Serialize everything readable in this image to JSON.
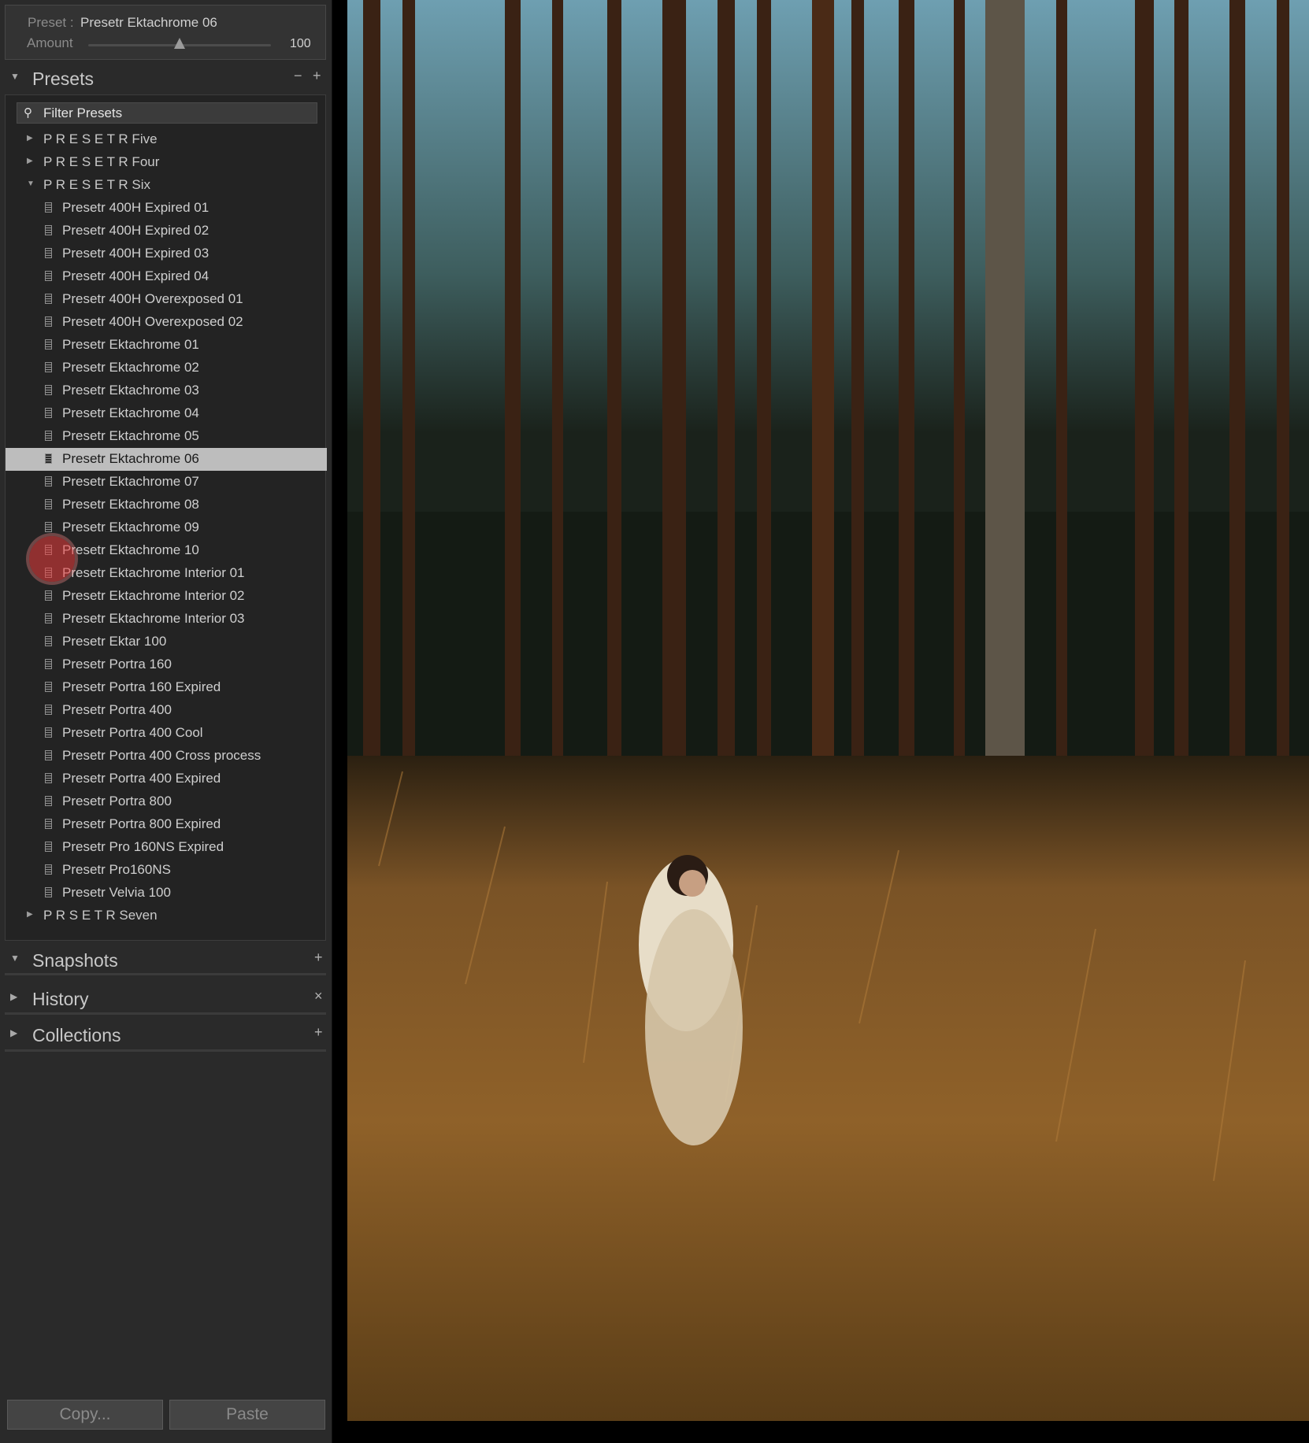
{
  "preset_bar": {
    "preset_label": "Preset :",
    "preset_value": "Presetr Ektachrome 06",
    "amount_label": "Amount",
    "amount_value": "100",
    "amount_fraction": 0.5
  },
  "presets_panel": {
    "title": "Presets",
    "minus": "−",
    "plus": "+",
    "filter_placeholder": "Filter Presets",
    "tree": [
      {
        "kind": "folder",
        "label": "P R E S E T R  Five",
        "expanded": false
      },
      {
        "kind": "folder",
        "label": "P R E S E T R  Four",
        "expanded": false
      },
      {
        "kind": "folder",
        "label": "P R E S E T R  Six",
        "expanded": true
      },
      {
        "kind": "item",
        "label": "Presetr 400H Expired 01"
      },
      {
        "kind": "item",
        "label": "Presetr 400H Expired 02"
      },
      {
        "kind": "item",
        "label": "Presetr 400H Expired 03"
      },
      {
        "kind": "item",
        "label": "Presetr 400H Expired 04"
      },
      {
        "kind": "item",
        "label": "Presetr 400H Overexposed 01"
      },
      {
        "kind": "item",
        "label": "Presetr 400H Overexposed 02"
      },
      {
        "kind": "item",
        "label": "Presetr Ektachrome 01"
      },
      {
        "kind": "item",
        "label": "Presetr Ektachrome 02"
      },
      {
        "kind": "item",
        "label": "Presetr Ektachrome 03"
      },
      {
        "kind": "item",
        "label": "Presetr Ektachrome 04"
      },
      {
        "kind": "item",
        "label": "Presetr Ektachrome 05"
      },
      {
        "kind": "item",
        "label": "Presetr Ektachrome 06",
        "selected": true
      },
      {
        "kind": "item",
        "label": "Presetr Ektachrome 07"
      },
      {
        "kind": "item",
        "label": "Presetr Ektachrome 08"
      },
      {
        "kind": "item",
        "label": "Presetr Ektachrome 09"
      },
      {
        "kind": "item",
        "label": "Presetr Ektachrome 10"
      },
      {
        "kind": "item",
        "label": "Presetr Ektachrome Interior 01"
      },
      {
        "kind": "item",
        "label": "Presetr Ektachrome Interior 02"
      },
      {
        "kind": "item",
        "label": "Presetr Ektachrome Interior 03"
      },
      {
        "kind": "item",
        "label": "Presetr Ektar 100"
      },
      {
        "kind": "item",
        "label": "Presetr Portra 160"
      },
      {
        "kind": "item",
        "label": "Presetr Portra 160 Expired"
      },
      {
        "kind": "item",
        "label": "Presetr Portra 400"
      },
      {
        "kind": "item",
        "label": "Presetr Portra 400 Cool"
      },
      {
        "kind": "item",
        "label": "Presetr Portra 400 Cross process"
      },
      {
        "kind": "item",
        "label": "Presetr Portra 400 Expired"
      },
      {
        "kind": "item",
        "label": "Presetr Portra 800"
      },
      {
        "kind": "item",
        "label": "Presetr Portra 800 Expired"
      },
      {
        "kind": "item",
        "label": "Presetr Pro 160NS Expired"
      },
      {
        "kind": "item",
        "label": "Presetr Pro160NS"
      },
      {
        "kind": "item",
        "label": "Presetr Velvia 100"
      },
      {
        "kind": "folder",
        "label": "P R S E T R  Seven",
        "expanded": false
      }
    ]
  },
  "snapshots_panel": {
    "title": "Snapshots",
    "action": "+"
  },
  "history_panel": {
    "title": "History",
    "action": "×"
  },
  "collections_panel": {
    "title": "Collections",
    "action": "+"
  },
  "buttons": {
    "copy": "Copy...",
    "paste": "Paste"
  },
  "icons": {
    "expanded": "triangle-down-icon",
    "collapsed": "triangle-right-icon",
    "preset": "preset-document-icon",
    "search": "magnifier-icon"
  }
}
